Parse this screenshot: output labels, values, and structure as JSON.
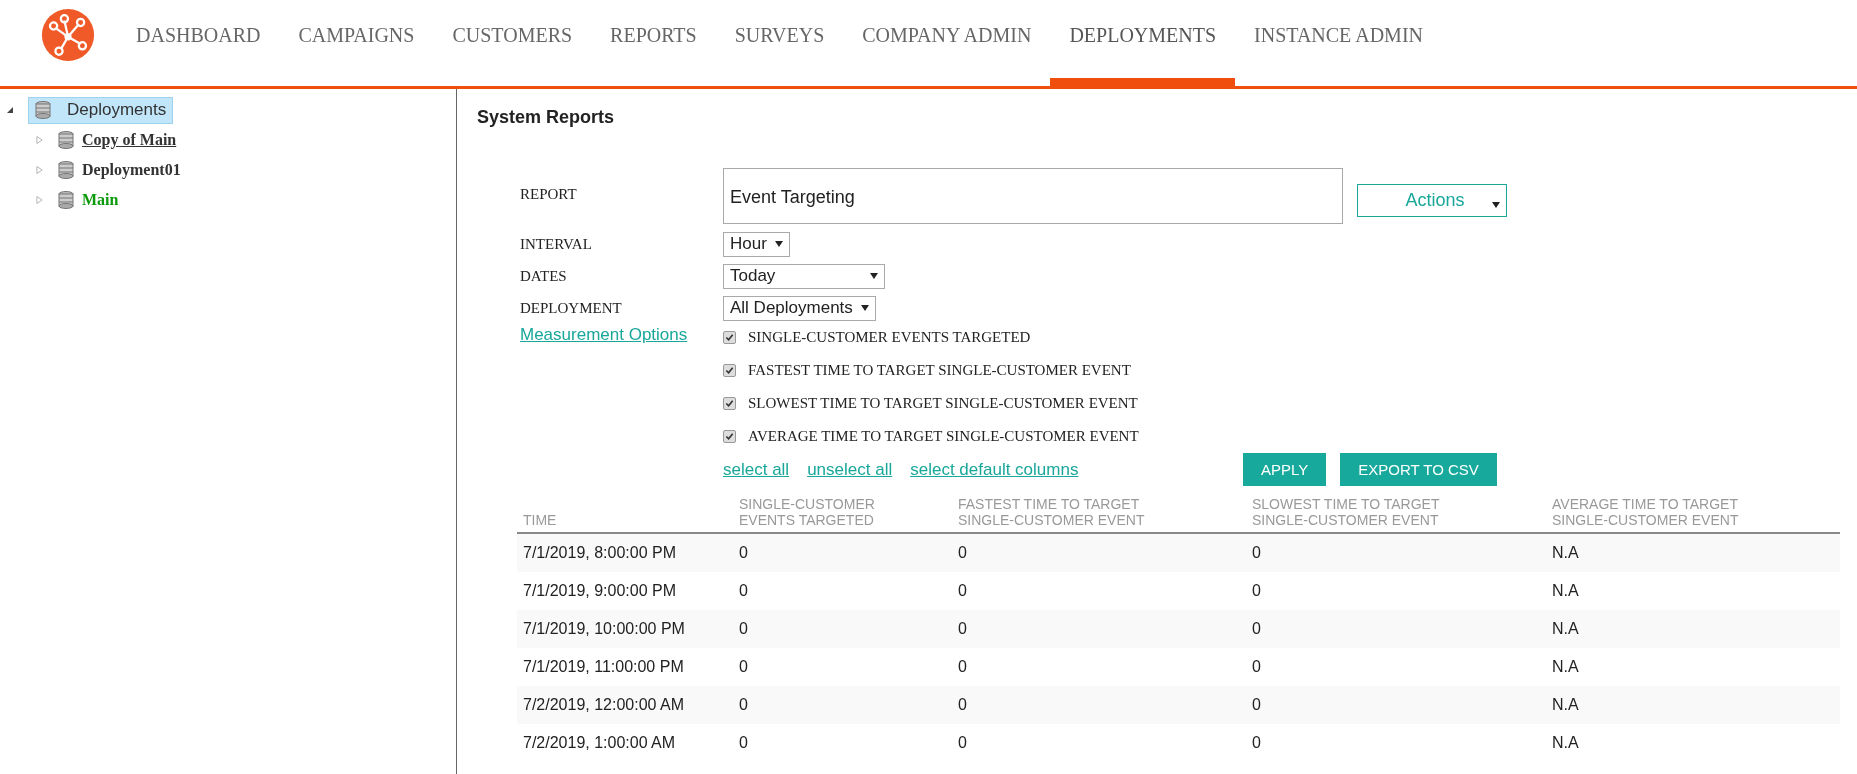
{
  "nav": [
    {
      "label": "DASHBOARD",
      "selected": false
    },
    {
      "label": "CAMPAIGNS",
      "selected": false
    },
    {
      "label": "CUSTOMERS",
      "selected": false
    },
    {
      "label": "REPORTS",
      "selected": false
    },
    {
      "label": "SURVEYS",
      "selected": false
    },
    {
      "label": "COMPANY ADMIN",
      "selected": false
    },
    {
      "label": "DEPLOYMENTS",
      "selected": true
    },
    {
      "label": "INSTANCE ADMIN",
      "selected": false
    }
  ],
  "tree": {
    "label": "Deployments",
    "expanded": true,
    "selected": true,
    "children": [
      {
        "label": "Copy of Main",
        "expanded": false,
        "hovered": true,
        "color": "#333333"
      },
      {
        "label": "Deployment01",
        "expanded": false,
        "hovered": false,
        "color": "#333333"
      },
      {
        "label": "Main",
        "expanded": false,
        "hovered": false,
        "color": "#0a9a0a"
      }
    ]
  },
  "title": "System Reports",
  "form": {
    "report_label": "REPORT",
    "report_value": "Event Targeting",
    "actions": "Actions",
    "selects": [
      {
        "label": "INTERVAL",
        "value": "Hour"
      },
      {
        "label": "DATES",
        "value": "Today"
      },
      {
        "label": "DEPLOYMENT",
        "value": "All Deployments"
      }
    ],
    "measurement_link": "Measurement Options",
    "options": [
      {
        "label": "SINGLE-CUSTOMER EVENTS TARGETED",
        "checked": true
      },
      {
        "label": "FASTEST TIME TO TARGET SINGLE-CUSTOMER EVENT",
        "checked": true
      },
      {
        "label": "SLOWEST TIME TO TARGET SINGLE-CUSTOMER EVENT",
        "checked": true
      },
      {
        "label": "AVERAGE TIME TO TARGET SINGLE-CUSTOMER EVENT",
        "checked": true
      }
    ],
    "links": [
      "select all",
      "unselect all",
      "select default columns"
    ],
    "buttons": [
      "APPLY",
      "EXPORT TO CSV"
    ]
  },
  "table": {
    "columns": [
      "TIME",
      "SINGLE-CUSTOMER EVENTS TARGETED",
      "FASTEST TIME TO TARGET SINGLE-CUSTOMER EVENT",
      "SLOWEST TIME TO TARGET SINGLE-CUSTOMER EVENT",
      "AVERAGE TIME TO TARGET SINGLE-CUSTOMER EVENT"
    ],
    "rows": [
      [
        "7/1/2019, 8:00:00 PM",
        "0",
        "0",
        "0",
        "N.A"
      ],
      [
        "7/1/2019, 9:00:00 PM",
        "0",
        "0",
        "0",
        "N.A"
      ],
      [
        "7/1/2019, 10:00:00 PM",
        "0",
        "0",
        "0",
        "N.A"
      ],
      [
        "7/1/2019, 11:00:00 PM",
        "0",
        "0",
        "0",
        "N.A"
      ],
      [
        "7/2/2019, 12:00:00 AM",
        "0",
        "0",
        "0",
        "N.A"
      ],
      [
        "7/2/2019, 1:00:00 AM",
        "0",
        "0",
        "0",
        "N.A"
      ]
    ]
  }
}
